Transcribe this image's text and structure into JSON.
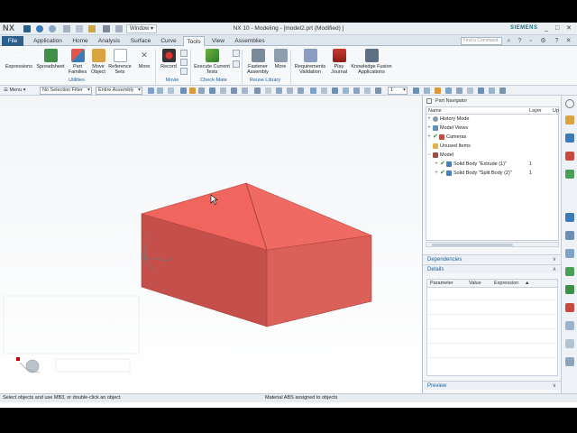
{
  "app": {
    "logo": "NX",
    "window_menu": "Window",
    "title": "NX 10 - Modeling - [model2.prt (Modified) ]",
    "brand": "SIEMENS",
    "command_search_placeholder": "Find a Command"
  },
  "tabs": {
    "file": "File",
    "items": [
      "Application",
      "Home",
      "Analysis",
      "Surface",
      "Curve",
      "Tools",
      "View",
      "Assemblies"
    ],
    "active": "Tools"
  },
  "ribbon": {
    "utilities": {
      "label": "Utilities",
      "buttons": [
        "Expressions",
        "Spreadsheet",
        "Part Families",
        "Move Object",
        "Reference Sets",
        "More"
      ]
    },
    "movie": {
      "label": "Movie",
      "buttons": [
        "Record"
      ]
    },
    "checkmate": {
      "label": "Check-Mate",
      "buttons": [
        "Execute Current Tests"
      ]
    },
    "reuse": {
      "label": "Reuse Library",
      "buttons": [
        "Fastener Assembly",
        "More"
      ]
    },
    "other_buttons": [
      "Requirements Validation",
      "Play Journal",
      "Knowledge Fusion Applications"
    ]
  },
  "selection_bar": {
    "menu": "Menu",
    "filter": "No Selection Filter",
    "scope": "Entire Assembly",
    "layer_value": "1"
  },
  "part_navigator": {
    "title": "Part Navigator",
    "columns": [
      "Name",
      "Layer",
      "Up"
    ],
    "rows": [
      {
        "label": "History Mode",
        "layer": ""
      },
      {
        "label": "Model Views",
        "layer": ""
      },
      {
        "label": "Cameras",
        "layer": ""
      },
      {
        "label": "Unused Items",
        "layer": ""
      },
      {
        "label": "Model",
        "layer": ""
      },
      {
        "label": "Solid Body \"Extrude (1)\"",
        "layer": "1"
      },
      {
        "label": "Solid Body \"Split Body (2)\"",
        "layer": "1"
      }
    ]
  },
  "panels": {
    "dependencies": "Dependencies",
    "details": "Details",
    "details_columns": [
      "Parameter",
      "Value",
      "Expression"
    ],
    "preview": "Preview"
  },
  "status": {
    "left": "Select objects and use MB3, or double-click an object",
    "middle": "Material ABS assigned to objects"
  },
  "colors": {
    "solid_top": "#f0665e",
    "solid_front": "#c7514c",
    "solid_right": "#d9605a",
    "accent": "#1f5f9a"
  }
}
